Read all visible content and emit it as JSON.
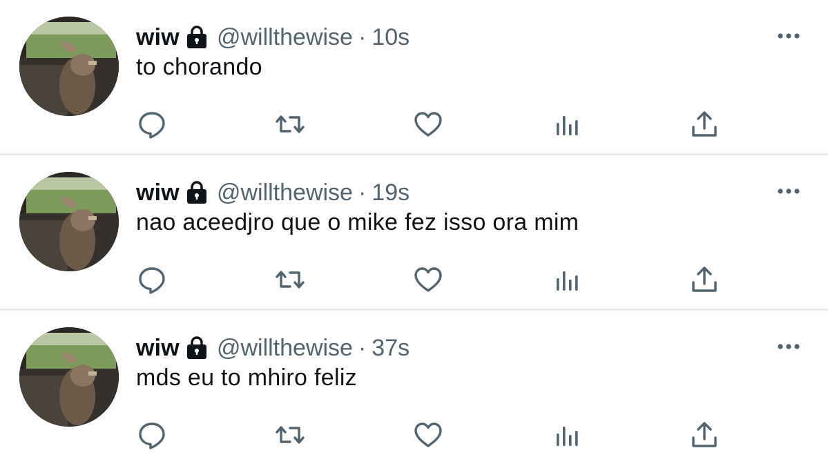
{
  "colors": {
    "text_primary": "#0f1419",
    "text_secondary": "#536471",
    "icon": "#536471",
    "divider": "#e9ecef"
  },
  "tweets": [
    {
      "name": "wiw",
      "handle": "@willthewise",
      "separator": "·",
      "time": "10s",
      "text": "to chorando"
    },
    {
      "name": "wiw",
      "handle": "@willthewise",
      "separator": "·",
      "time": "19s",
      "text": "nao aceedjro que o mike fez isso ora mim"
    },
    {
      "name": "wiw",
      "handle": "@willthewise",
      "separator": "·",
      "time": "37s",
      "text": "mds eu to mhiro feliz"
    }
  ],
  "icons": {
    "lock": "lock-icon",
    "more": "more-icon",
    "reply": "reply-icon",
    "retweet": "retweet-icon",
    "like": "like-icon",
    "views": "views-icon",
    "share": "share-icon"
  }
}
